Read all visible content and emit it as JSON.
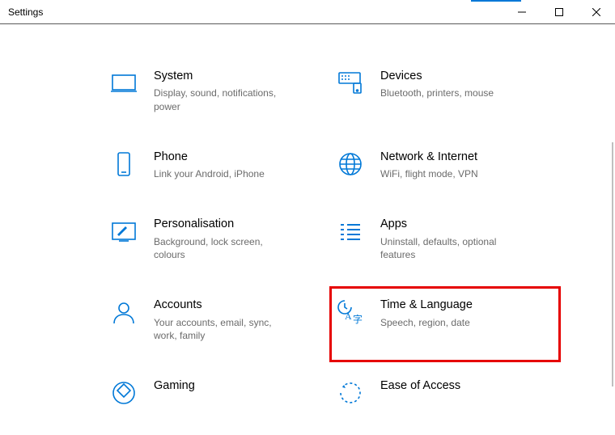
{
  "window": {
    "title": "Settings"
  },
  "tiles": {
    "system": {
      "title": "System",
      "desc": "Display, sound, notifications, power"
    },
    "devices": {
      "title": "Devices",
      "desc": "Bluetooth, printers, mouse"
    },
    "phone": {
      "title": "Phone",
      "desc": "Link your Android, iPhone"
    },
    "network": {
      "title": "Network & Internet",
      "desc": "WiFi, flight mode, VPN"
    },
    "personalisation": {
      "title": "Personalisation",
      "desc": "Background, lock screen, colours"
    },
    "apps": {
      "title": "Apps",
      "desc": "Uninstall, defaults, optional features"
    },
    "accounts": {
      "title": "Accounts",
      "desc": "Your accounts, email, sync, work, family"
    },
    "time": {
      "title": "Time & Language",
      "desc": "Speech, region, date"
    },
    "gaming": {
      "title": "Gaming",
      "desc": ""
    },
    "ease": {
      "title": "Ease of Access",
      "desc": ""
    }
  }
}
